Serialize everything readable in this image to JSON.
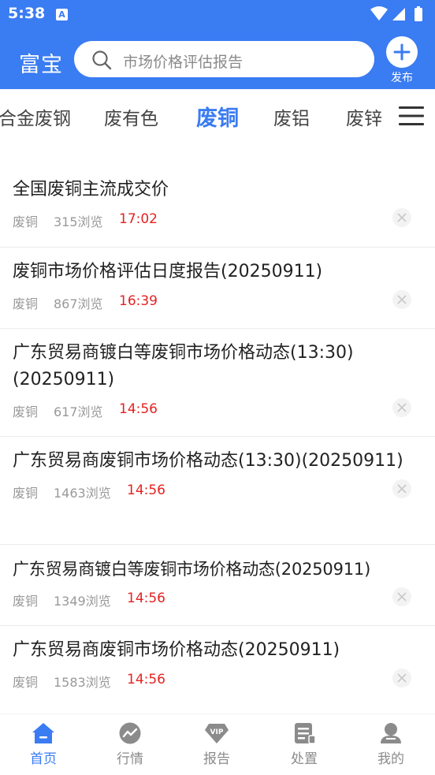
{
  "status_bar": {
    "time": "5:38",
    "badge": "A"
  },
  "header": {
    "brand": "富宝",
    "search_placeholder": "市场价格评估报告",
    "publish_label": "发布"
  },
  "tabs": [
    {
      "label": "合金废钢"
    },
    {
      "label": "废有色"
    },
    {
      "label": "废铜",
      "active": true
    },
    {
      "label": "废铝"
    },
    {
      "label": "废锌"
    }
  ],
  "articles": [
    {
      "title": "全国废铜主流成交价",
      "category": "废铜",
      "views": "315浏览",
      "time": "17:02"
    },
    {
      "title": "废铜市场价格评估日度报告(20250911)",
      "category": "废铜",
      "views": "867浏览",
      "time": "16:39"
    },
    {
      "title": "广东贸易商镀白等废铜市场价格动态(13:30)(20250911)",
      "category": "废铜",
      "views": "617浏览",
      "time": "14:56"
    },
    {
      "title": "广东贸易商废铜市场价格动态(13:30)(20250911)",
      "category": "废铜",
      "views": "1463浏览",
      "time": "14:56"
    },
    {
      "title": "广东贸易商镀白等废铜市场价格动态(20250911)",
      "category": "废铜",
      "views": "1349浏览",
      "time": "14:56"
    },
    {
      "title": "广东贸易商废铜市场价格动态(20250911)",
      "category": "废铜",
      "views": "1583浏览",
      "time": "14:56"
    }
  ],
  "bottom_nav": [
    {
      "label": "首页",
      "icon": "home-icon",
      "active": true
    },
    {
      "label": "行情",
      "icon": "trend-icon"
    },
    {
      "label": "报告",
      "icon": "vip-icon"
    },
    {
      "label": "处置",
      "icon": "dispose-icon"
    },
    {
      "label": "我的",
      "icon": "profile-icon"
    }
  ],
  "colors": {
    "primary": "#3a7cf2",
    "time_red": "#e52222"
  }
}
